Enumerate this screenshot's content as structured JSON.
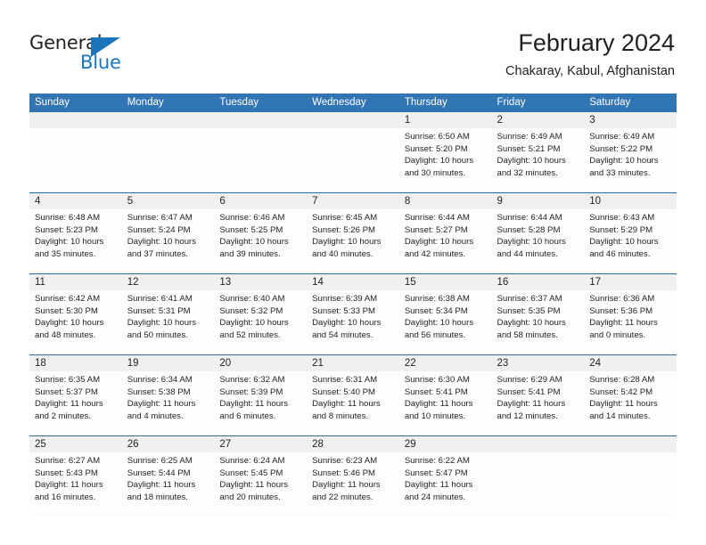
{
  "brand": {
    "name_part1": "General",
    "name_part2": "Blue",
    "triangle_color": "#1b75bb"
  },
  "header": {
    "title": "February 2024",
    "subtitle": "Chakaray, Kabul, Afghanistan"
  },
  "theme": {
    "header_blue": "#3275b5",
    "divider_blue": "#2a6ca8",
    "number_band": "#f0f0f0",
    "text": "#231f20"
  },
  "weekdays": [
    "Sunday",
    "Monday",
    "Tuesday",
    "Wednesday",
    "Thursday",
    "Friday",
    "Saturday"
  ],
  "weeks": [
    [
      {
        "day": "",
        "lines": []
      },
      {
        "day": "",
        "lines": []
      },
      {
        "day": "",
        "lines": []
      },
      {
        "day": "",
        "lines": []
      },
      {
        "day": "1",
        "lines": [
          "Sunrise: 6:50 AM",
          "Sunset: 5:20 PM",
          "Daylight: 10 hours",
          "and 30 minutes."
        ]
      },
      {
        "day": "2",
        "lines": [
          "Sunrise: 6:49 AM",
          "Sunset: 5:21 PM",
          "Daylight: 10 hours",
          "and 32 minutes."
        ]
      },
      {
        "day": "3",
        "lines": [
          "Sunrise: 6:49 AM",
          "Sunset: 5:22 PM",
          "Daylight: 10 hours",
          "and 33 minutes."
        ]
      }
    ],
    [
      {
        "day": "4",
        "lines": [
          "Sunrise: 6:48 AM",
          "Sunset: 5:23 PM",
          "Daylight: 10 hours",
          "and 35 minutes."
        ]
      },
      {
        "day": "5",
        "lines": [
          "Sunrise: 6:47 AM",
          "Sunset: 5:24 PM",
          "Daylight: 10 hours",
          "and 37 minutes."
        ]
      },
      {
        "day": "6",
        "lines": [
          "Sunrise: 6:46 AM",
          "Sunset: 5:25 PM",
          "Daylight: 10 hours",
          "and 39 minutes."
        ]
      },
      {
        "day": "7",
        "lines": [
          "Sunrise: 6:45 AM",
          "Sunset: 5:26 PM",
          "Daylight: 10 hours",
          "and 40 minutes."
        ]
      },
      {
        "day": "8",
        "lines": [
          "Sunrise: 6:44 AM",
          "Sunset: 5:27 PM",
          "Daylight: 10 hours",
          "and 42 minutes."
        ]
      },
      {
        "day": "9",
        "lines": [
          "Sunrise: 6:44 AM",
          "Sunset: 5:28 PM",
          "Daylight: 10 hours",
          "and 44 minutes."
        ]
      },
      {
        "day": "10",
        "lines": [
          "Sunrise: 6:43 AM",
          "Sunset: 5:29 PM",
          "Daylight: 10 hours",
          "and 46 minutes."
        ]
      }
    ],
    [
      {
        "day": "11",
        "lines": [
          "Sunrise: 6:42 AM",
          "Sunset: 5:30 PM",
          "Daylight: 10 hours",
          "and 48 minutes."
        ]
      },
      {
        "day": "12",
        "lines": [
          "Sunrise: 6:41 AM",
          "Sunset: 5:31 PM",
          "Daylight: 10 hours",
          "and 50 minutes."
        ]
      },
      {
        "day": "13",
        "lines": [
          "Sunrise: 6:40 AM",
          "Sunset: 5:32 PM",
          "Daylight: 10 hours",
          "and 52 minutes."
        ]
      },
      {
        "day": "14",
        "lines": [
          "Sunrise: 6:39 AM",
          "Sunset: 5:33 PM",
          "Daylight: 10 hours",
          "and 54 minutes."
        ]
      },
      {
        "day": "15",
        "lines": [
          "Sunrise: 6:38 AM",
          "Sunset: 5:34 PM",
          "Daylight: 10 hours",
          "and 56 minutes."
        ]
      },
      {
        "day": "16",
        "lines": [
          "Sunrise: 6:37 AM",
          "Sunset: 5:35 PM",
          "Daylight: 10 hours",
          "and 58 minutes."
        ]
      },
      {
        "day": "17",
        "lines": [
          "Sunrise: 6:36 AM",
          "Sunset: 5:36 PM",
          "Daylight: 11 hours",
          "and 0 minutes."
        ]
      }
    ],
    [
      {
        "day": "18",
        "lines": [
          "Sunrise: 6:35 AM",
          "Sunset: 5:37 PM",
          "Daylight: 11 hours",
          "and 2 minutes."
        ]
      },
      {
        "day": "19",
        "lines": [
          "Sunrise: 6:34 AM",
          "Sunset: 5:38 PM",
          "Daylight: 11 hours",
          "and 4 minutes."
        ]
      },
      {
        "day": "20",
        "lines": [
          "Sunrise: 6:32 AM",
          "Sunset: 5:39 PM",
          "Daylight: 11 hours",
          "and 6 minutes."
        ]
      },
      {
        "day": "21",
        "lines": [
          "Sunrise: 6:31 AM",
          "Sunset: 5:40 PM",
          "Daylight: 11 hours",
          "and 8 minutes."
        ]
      },
      {
        "day": "22",
        "lines": [
          "Sunrise: 6:30 AM",
          "Sunset: 5:41 PM",
          "Daylight: 11 hours",
          "and 10 minutes."
        ]
      },
      {
        "day": "23",
        "lines": [
          "Sunrise: 6:29 AM",
          "Sunset: 5:41 PM",
          "Daylight: 11 hours",
          "and 12 minutes."
        ]
      },
      {
        "day": "24",
        "lines": [
          "Sunrise: 6:28 AM",
          "Sunset: 5:42 PM",
          "Daylight: 11 hours",
          "and 14 minutes."
        ]
      }
    ],
    [
      {
        "day": "25",
        "lines": [
          "Sunrise: 6:27 AM",
          "Sunset: 5:43 PM",
          "Daylight: 11 hours",
          "and 16 minutes."
        ]
      },
      {
        "day": "26",
        "lines": [
          "Sunrise: 6:25 AM",
          "Sunset: 5:44 PM",
          "Daylight: 11 hours",
          "and 18 minutes."
        ]
      },
      {
        "day": "27",
        "lines": [
          "Sunrise: 6:24 AM",
          "Sunset: 5:45 PM",
          "Daylight: 11 hours",
          "and 20 minutes."
        ]
      },
      {
        "day": "28",
        "lines": [
          "Sunrise: 6:23 AM",
          "Sunset: 5:46 PM",
          "Daylight: 11 hours",
          "and 22 minutes."
        ]
      },
      {
        "day": "29",
        "lines": [
          "Sunrise: 6:22 AM",
          "Sunset: 5:47 PM",
          "Daylight: 11 hours",
          "and 24 minutes."
        ]
      },
      {
        "day": "",
        "lines": []
      },
      {
        "day": "",
        "lines": []
      }
    ]
  ]
}
